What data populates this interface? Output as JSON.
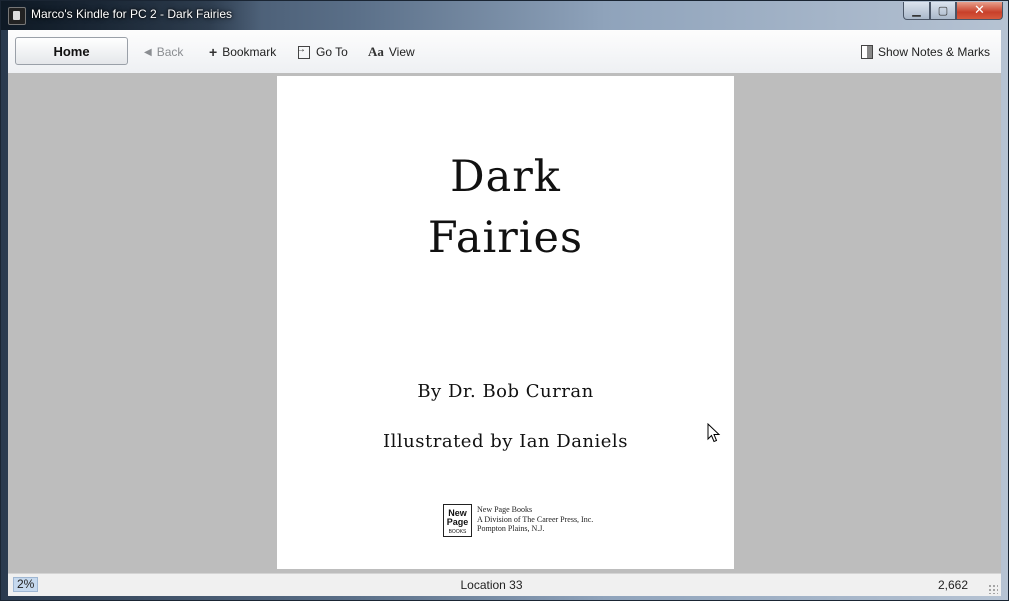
{
  "window": {
    "title": "Marco's Kindle for PC 2 - Dark Fairies",
    "controls": {
      "minimize": "▁",
      "maximize": "▢",
      "close": "✕"
    }
  },
  "toolbar": {
    "home_label": "Home",
    "back_label": "Back",
    "bookmark_label": "Bookmark",
    "goto_label": "Go To",
    "view_icon_text": "Aa",
    "view_label": "View",
    "notes_label": "Show Notes & Marks"
  },
  "page": {
    "title_line1": "Dark",
    "title_line2": "Fairies",
    "author": "By Dr. Bob Curran",
    "illustrator": "Illustrated by Ian Daniels",
    "publisher_logo": {
      "line1": "New",
      "line2": "Page",
      "line3": "BOOKS"
    },
    "publisher_lines": [
      "New Page Books",
      "A Division of The Career Press, Inc.",
      "Pompton Plains, N.J."
    ]
  },
  "status": {
    "percent": "2%",
    "location": "Location 33",
    "total": "2,662"
  }
}
